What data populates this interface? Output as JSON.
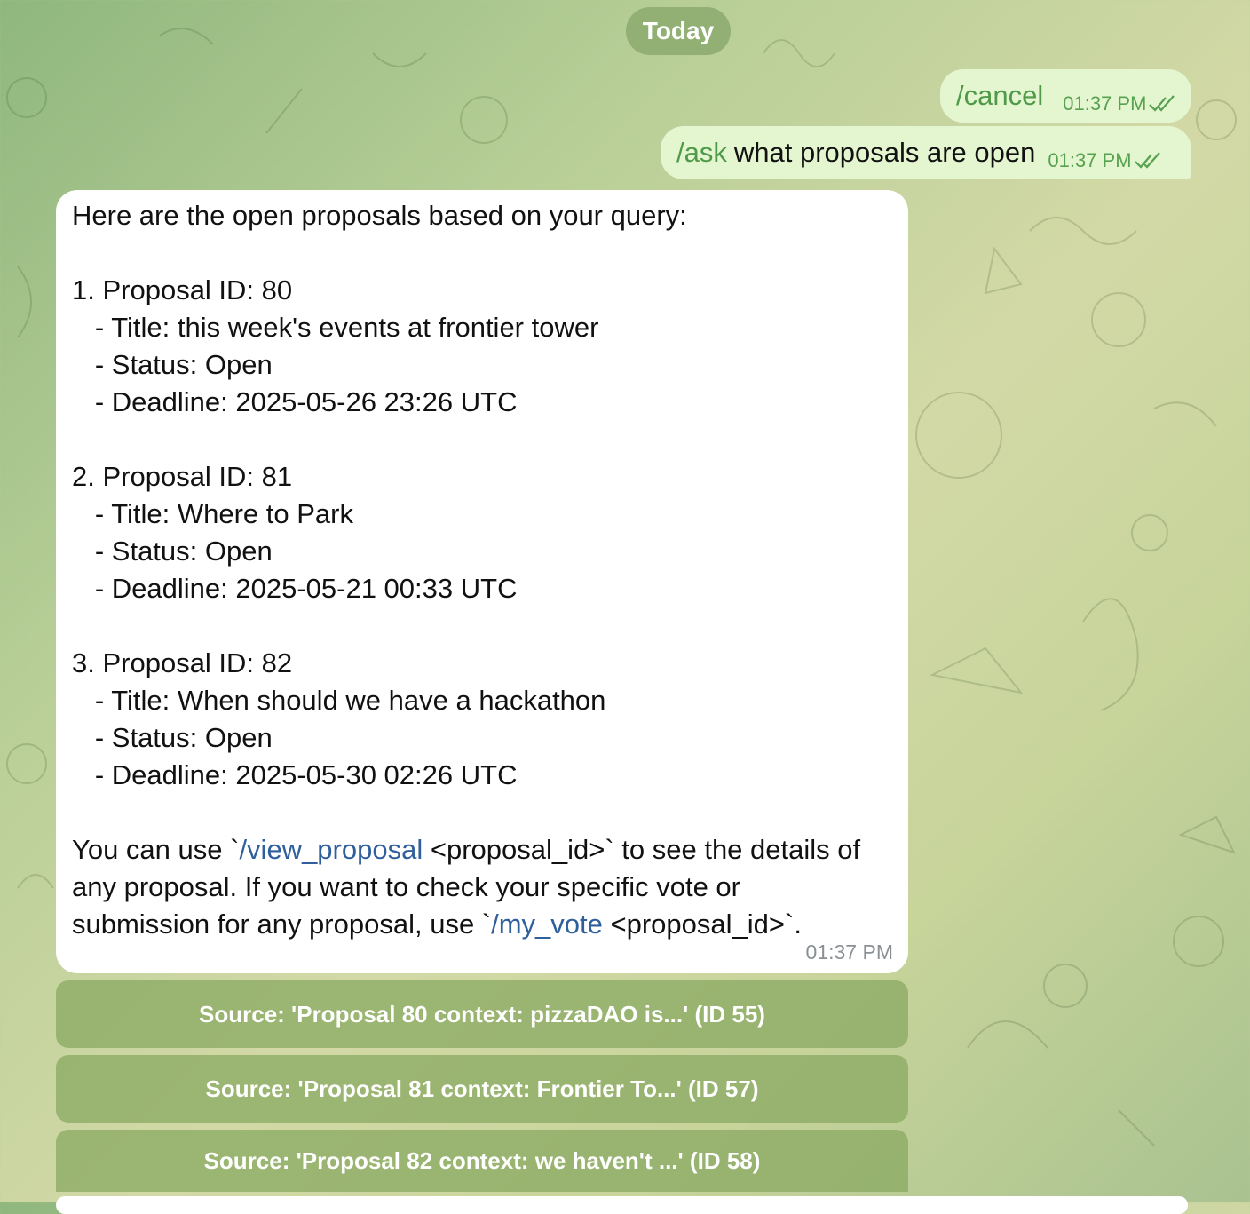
{
  "date_separator": "Today",
  "outgoing_messages": [
    {
      "command": "/cancel",
      "text": "",
      "time": "01:37 PM"
    },
    {
      "command": "/ask",
      "text": "what proposals are open",
      "time": "01:37 PM"
    }
  ],
  "incoming_message": {
    "intro": "Here are the open proposals based on your query:",
    "proposals": [
      {
        "heading": "1. Proposal ID: 80",
        "title": "   - Title: this week's events at frontier tower",
        "status": "   - Status: Open",
        "deadline": "   - Deadline: 2025-05-26 23:26 UTC"
      },
      {
        "heading": "2. Proposal ID: 81",
        "title": "   - Title: Where to Park",
        "status": "   - Status: Open",
        "deadline": "   - Deadline: 2025-05-21 00:33 UTC"
      },
      {
        "heading": "3. Proposal ID: 82",
        "title": "   - Title: When should we have a hackathon",
        "status": "   - Status: Open",
        "deadline": "   - Deadline: 2025-05-30 02:26 UTC"
      }
    ],
    "footer_part1": "You can use `",
    "footer_link1": "/view_proposal",
    "footer_part2": " <proposal_id>` to see the details of\nany proposal. If you want to check your specific vote or\nsubmission for any proposal, use `",
    "footer_link2": "/my_vote",
    "footer_part3": " <proposal_id>`.",
    "time": "01:37 PM"
  },
  "source_buttons": [
    "Source: 'Proposal 80 context: pizzaDAO is...' (ID 55)",
    "Source: 'Proposal 81 context: Frontier To...' (ID 57)",
    "Source: 'Proposal 82 context: we haven't ...' (ID 58)"
  ],
  "colors": {
    "outgoing_bubble": "#e3f6d0",
    "command": "#4f9a48",
    "link": "#2f5f9c",
    "source_button": "#8caa64"
  }
}
